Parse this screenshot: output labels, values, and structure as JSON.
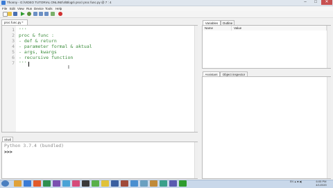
{
  "window": {
    "title": "Thonny - G:\\VIDEO TUTORIAL ONLINE\\4\\Blogs\\ proc\\ proc func.py @ 7 : 4",
    "controls": [
      "–",
      "□",
      "✕"
    ]
  },
  "menubar": [
    "File",
    "Edit",
    "View",
    "Run",
    "Device",
    "Tools",
    "Help"
  ],
  "toolbar": {
    "icons": [
      "new-file",
      "open-file",
      "save-file",
      "run",
      "debug",
      "step-over",
      "step-into",
      "step-out",
      "resume",
      "stop"
    ],
    "colors": {
      "run": "#2e9c2e",
      "stop": "#d03030",
      "file": "#e8c24a"
    }
  },
  "editor": {
    "tab_label": "proc func.py *",
    "lines": [
      {
        "n": "1",
        "text": "'''"
      },
      {
        "n": "2",
        "text": "proc & func :"
      },
      {
        "n": "3",
        "text": "- def & return"
      },
      {
        "n": "4",
        "text": "- parameter formal & aktual"
      },
      {
        "n": "5",
        "text": "- args, kwargs"
      },
      {
        "n": "6",
        "text": "- recursive function"
      },
      {
        "n": "7",
        "text": "'''"
      }
    ]
  },
  "shell": {
    "tab_label": "Shell",
    "banner": "Python 3.7.4 (bundled)",
    "prompt": ">>>"
  },
  "variables": {
    "tabs": [
      "Variables",
      "Outline"
    ],
    "columns": [
      "Name",
      "Value"
    ]
  },
  "assistant": {
    "tabs": [
      "Assistant",
      "Object inspector"
    ]
  },
  "taskbar": {
    "tray_text": "EN ▲ ■ ◀)",
    "clock_time": "6:05 PM",
    "clock_date": "4/1/2020"
  }
}
